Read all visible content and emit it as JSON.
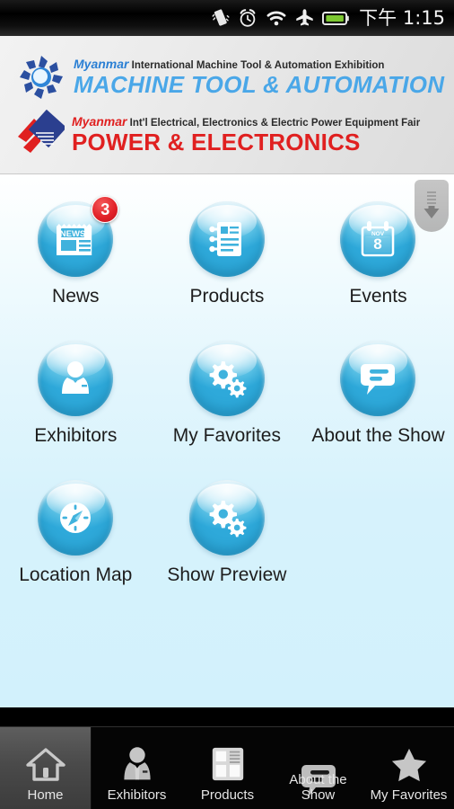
{
  "statusbar": {
    "time": "下午 1:15",
    "icons": [
      "vibrate-icon",
      "alarm-icon",
      "wifi-icon",
      "airplane-mode-icon",
      "battery-icon"
    ]
  },
  "banner": {
    "logo1": {
      "mark": "machine-tool-logo-mark",
      "brand": "Myanmar",
      "subtitle": "International Machine Tool & Automation Exhibition",
      "title": "MACHINE TOOL &  AUTOMATION",
      "brand_color": "#2a7fd4",
      "title_color": "#4aa7e8"
    },
    "logo2": {
      "mark": "power-electronics-logo-mark",
      "brand": "Myanmar",
      "subtitle": "Int'l Electrical, Electronics & Electric Power Equipment Fair",
      "title": "POWER & ELECTRONICS",
      "brand_color": "#e02020",
      "title_color": "#e02020"
    }
  },
  "scroll_cue": "scroll-down-icon",
  "menu": {
    "items": [
      {
        "label": "News",
        "icon": "newspaper-icon",
        "badge": "3"
      },
      {
        "label": "Products",
        "icon": "document-list-icon",
        "badge": ""
      },
      {
        "label": "Events",
        "icon": "calendar-icon",
        "badge": ""
      },
      {
        "label": "Exhibitors",
        "icon": "businessperson-icon",
        "badge": ""
      },
      {
        "label": "My Favorites",
        "icon": "gears-icon",
        "badge": ""
      },
      {
        "label": "About the Show",
        "icon": "speech-bubble-icon",
        "badge": ""
      },
      {
        "label": "Location Map",
        "icon": "compass-icon",
        "badge": ""
      },
      {
        "label": "Show Preview",
        "icon": "gears-icon",
        "badge": ""
      }
    ],
    "calendar_month": "NOV",
    "calendar_day": "8",
    "news_glyph_text": "NEWS"
  },
  "tabbar": {
    "tabs": [
      {
        "label": "Home",
        "icon": "home-icon",
        "active": true
      },
      {
        "label": "Exhibitors",
        "icon": "businessperson-icon",
        "active": false
      },
      {
        "label": "Products",
        "icon": "books-icon",
        "active": false
      },
      {
        "label": "About the Show",
        "icon": "speech-bubble-icon",
        "active": false
      },
      {
        "label": "My Favorites",
        "icon": "star-icon",
        "active": false
      }
    ]
  },
  "colors": {
    "orb_blue": "#2ea9da",
    "badge_red": "#e12027",
    "content_bg": "#d2f1fc",
    "banner_bg": "#eaeaea",
    "tabbar_bg": "#050505"
  }
}
